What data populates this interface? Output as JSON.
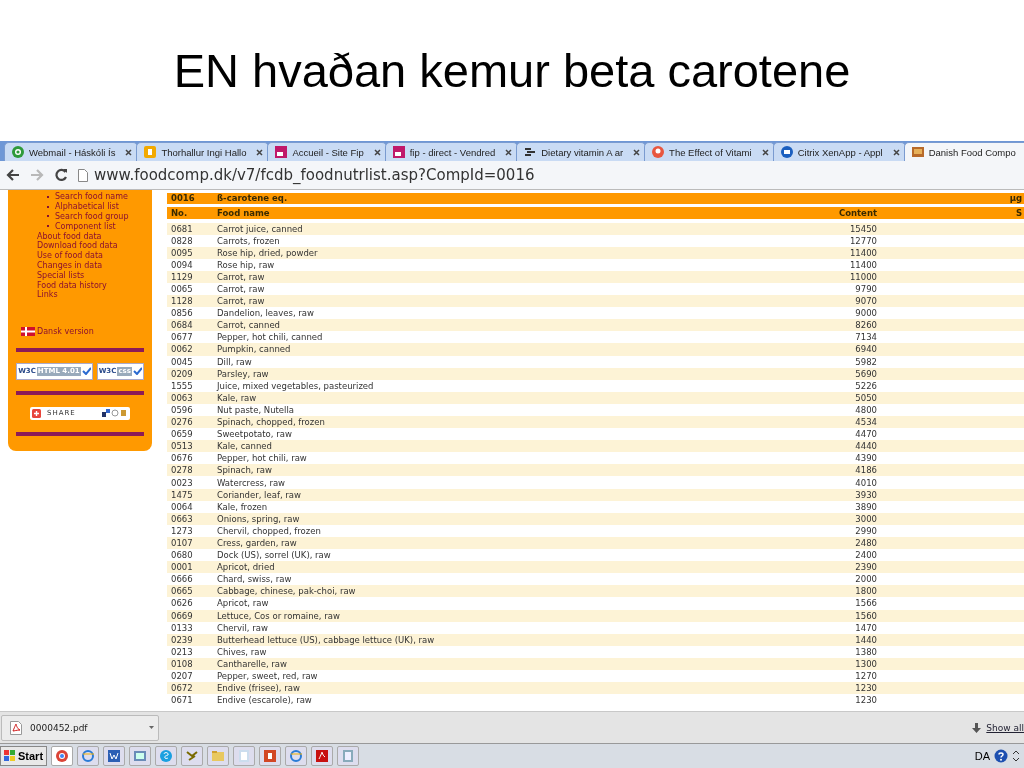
{
  "slide_title": "EN hvaðan kemur beta carotene",
  "tabs": [
    {
      "title": "Webmail - Háskóli Ís",
      "selected": false
    },
    {
      "title": "Thorhallur Ingi Hallo",
      "selected": false
    },
    {
      "title": "Accueil - Site Fip",
      "selected": false
    },
    {
      "title": "fip - direct - Vendred",
      "selected": false
    },
    {
      "title": "Dietary vitamin A ar",
      "selected": false
    },
    {
      "title": "The Effect of Vitami",
      "selected": false
    },
    {
      "title": "Citrix XenApp - Appl",
      "selected": false
    },
    {
      "title": "Danish Food Compo",
      "selected": true
    }
  ],
  "address_bar": {
    "url": "www.foodcomp.dk/v7/fcdb_foodnutrlist.asp?CompId=0016",
    "forward_disabled": true
  },
  "sidebar": {
    "items": [
      {
        "label": "Search food name",
        "kind": "sub"
      },
      {
        "label": "Alphabetical list",
        "kind": "sub"
      },
      {
        "label": "Search food group",
        "kind": "sub"
      },
      {
        "label": "Component list",
        "kind": "sub"
      },
      {
        "label": "About food data",
        "kind": "main"
      },
      {
        "label": "Download food data",
        "kind": "main"
      },
      {
        "label": "Use of food data",
        "kind": "main"
      },
      {
        "label": "Changes in data",
        "kind": "main"
      },
      {
        "label": "Special lists",
        "kind": "main"
      },
      {
        "label": "Food data history",
        "kind": "main"
      },
      {
        "label": "Links",
        "kind": "main"
      }
    ],
    "language_link": "Dansk version",
    "badges": [
      {
        "logo": "W3C",
        "label": "HTML 4.01"
      },
      {
        "logo": "W3C",
        "label": "css"
      }
    ],
    "share_button": "SHARE"
  },
  "table": {
    "component": {
      "no": "0016",
      "name": "ß-carotene eq.",
      "unit": "µg"
    },
    "columns": [
      "No.",
      "Food name",
      "Content",
      "S"
    ],
    "rows": [
      {
        "no": "0681",
        "name": "Carrot juice, canned",
        "content": "15450"
      },
      {
        "no": "0828",
        "name": "Carrots, frozen",
        "content": "12770"
      },
      {
        "no": "0095",
        "name": "Rose hip, dried, powder",
        "content": "11400"
      },
      {
        "no": "0094",
        "name": "Rose hip, raw",
        "content": "11400"
      },
      {
        "no": "1129",
        "name": "Carrot, raw",
        "content": "11000"
      },
      {
        "no": "0065",
        "name": "Carrot, raw",
        "content": "9790"
      },
      {
        "no": "1128",
        "name": "Carrot, raw",
        "content": "9070"
      },
      {
        "no": "0856",
        "name": "Dandelion, leaves, raw",
        "content": "9000"
      },
      {
        "no": "0684",
        "name": "Carrot, canned",
        "content": "8260"
      },
      {
        "no": "0677",
        "name": "Pepper, hot chili, canned",
        "content": "7134"
      },
      {
        "no": "0062",
        "name": "Pumpkin, canned",
        "content": "6940"
      },
      {
        "no": "0045",
        "name": "Dill, raw",
        "content": "5982"
      },
      {
        "no": "0209",
        "name": "Parsley, raw",
        "content": "5690"
      },
      {
        "no": "1555",
        "name": "Juice, mixed vegetables, pasteurized",
        "content": "5226"
      },
      {
        "no": "0063",
        "name": "Kale, raw",
        "content": "5050"
      },
      {
        "no": "0596",
        "name": "Nut paste, Nutella",
        "content": "4800"
      },
      {
        "no": "0276",
        "name": "Spinach, chopped, frozen",
        "content": "4534"
      },
      {
        "no": "0659",
        "name": "Sweetpotato, raw",
        "content": "4470"
      },
      {
        "no": "0513",
        "name": "Kale, canned",
        "content": "4440"
      },
      {
        "no": "0676",
        "name": "Pepper, hot chili, raw",
        "content": "4390"
      },
      {
        "no": "0278",
        "name": "Spinach, raw",
        "content": "4186"
      },
      {
        "no": "0023",
        "name": "Watercress, raw",
        "content": "4010"
      },
      {
        "no": "1475",
        "name": "Coriander, leaf, raw",
        "content": "3930"
      },
      {
        "no": "0064",
        "name": "Kale, frozen",
        "content": "3890"
      },
      {
        "no": "0663",
        "name": "Onions, spring, raw",
        "content": "3000"
      },
      {
        "no": "1273",
        "name": "Chervil, chopped, frozen",
        "content": "2990"
      },
      {
        "no": "0107",
        "name": "Cress, garden, raw",
        "content": "2480"
      },
      {
        "no": "0680",
        "name": "Dock (US), sorrel (UK), raw",
        "content": "2400"
      },
      {
        "no": "0001",
        "name": "Apricot, dried",
        "content": "2390"
      },
      {
        "no": "0666",
        "name": "Chard, swiss, raw",
        "content": "2000"
      },
      {
        "no": "0665",
        "name": "Cabbage, chinese, pak-choi, raw",
        "content": "1800"
      },
      {
        "no": "0626",
        "name": "Apricot, raw",
        "content": "1566"
      },
      {
        "no": "0669",
        "name": "Lettuce, Cos or romaine, raw",
        "content": "1560"
      },
      {
        "no": "0133",
        "name": "Chervil, raw",
        "content": "1470"
      },
      {
        "no": "0239",
        "name": "Butterhead lettuce (US), cabbage lettuce (UK), raw",
        "content": "1440"
      },
      {
        "no": "0213",
        "name": "Chives, raw",
        "content": "1380"
      },
      {
        "no": "0108",
        "name": "Cantharelle, raw",
        "content": "1300"
      },
      {
        "no": "0207",
        "name": "Pepper, sweet, red, raw",
        "content": "1270"
      },
      {
        "no": "0672",
        "name": "Endive (frisee), raw",
        "content": "1230"
      },
      {
        "no": "0671",
        "name": "Endive (escarole), raw",
        "content": "1230"
      }
    ]
  },
  "download_bar": {
    "file": "0000452.pdf",
    "show_all": "Show all"
  },
  "taskbar": {
    "start": "Start",
    "language": "DA"
  }
}
